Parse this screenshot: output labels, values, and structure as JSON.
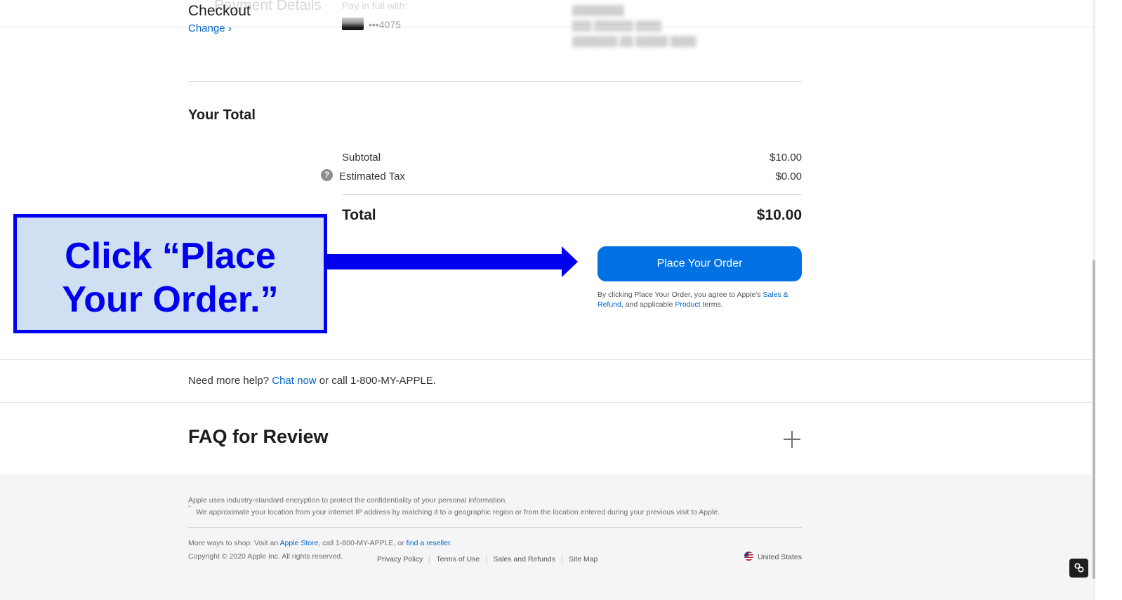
{
  "header": {
    "title": "Checkout",
    "change_link": "Change ›",
    "faded_heading": "Payment Details",
    "pay_label": "Pay in full with:",
    "card_number": "•••4075"
  },
  "totals": {
    "section_title": "Your Total",
    "subtotal_label": "Subtotal",
    "subtotal_value": "$10.00",
    "tax_help_icon": "?",
    "tax_label": "Estimated Tax",
    "tax_value": "$0.00",
    "total_label": "Total",
    "total_value": "$10.00"
  },
  "order": {
    "button_label": "Place Your Order",
    "terms_pre": "By clicking Place Your Order, you agree to Apple's ",
    "terms_link1": "Sales & Refund",
    "terms_mid": ", and applicable ",
    "terms_link2": "Product",
    "terms_post": " terms."
  },
  "annotation": {
    "line1": "Click “Place",
    "line2": "Your Order.”"
  },
  "help": {
    "prefix": "Need more help? ",
    "chat_link": "Chat now",
    "suffix": " or call 1-800-MY-APPLE."
  },
  "faq": {
    "title": "FAQ for Review",
    "expand_icon": "plus-icon"
  },
  "footer": {
    "encryption_note": "Apple uses industry-standard encryption to protect the confidentiality of your personal information.",
    "location_note": "We approximate your location from your internet IP address by matching it to a geographic region or from the location entered during your previous visit to Apple.",
    "more_ways_pre": "More ways to shop: Visit an ",
    "apple_store_link": "Apple Store",
    "more_ways_mid": ", call 1-800-MY-APPLE, or ",
    "reseller_link": "find a reseller",
    "more_ways_post": ".",
    "copyright": "Copyright © 2020 Apple Inc. All rights reserved.",
    "legal_links": [
      "Privacy Policy",
      "Terms of Use",
      "Sales and Refunds",
      "Site Map"
    ],
    "country": "United States"
  },
  "colors": {
    "accent": "#0071e3",
    "link": "#0066cc",
    "annotation": "#0000ee",
    "annotation_bg": "#cfe0f2"
  }
}
